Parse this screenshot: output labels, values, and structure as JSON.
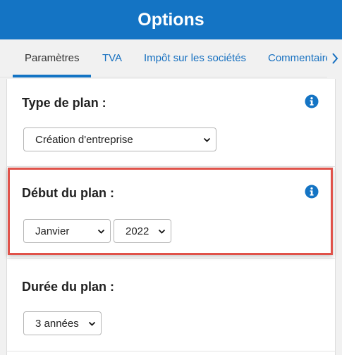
{
  "header": {
    "title": "Options"
  },
  "tabs": [
    {
      "label": "Paramètres",
      "active": true
    },
    {
      "label": "TVA",
      "active": false
    },
    {
      "label": "Impôt sur les sociétés",
      "active": false
    },
    {
      "label": "Commentaires",
      "active": false
    }
  ],
  "sections": {
    "plan_type": {
      "title": "Type de plan :",
      "select_value": "Création d'entreprise"
    },
    "plan_start": {
      "title": "Début du plan :",
      "month_value": "Janvier",
      "year_value": "2022"
    },
    "plan_duration": {
      "title": "Durée du plan :",
      "select_value": "3 années"
    }
  },
  "colors": {
    "brand": "#1474c4",
    "highlight": "#e0524a"
  }
}
